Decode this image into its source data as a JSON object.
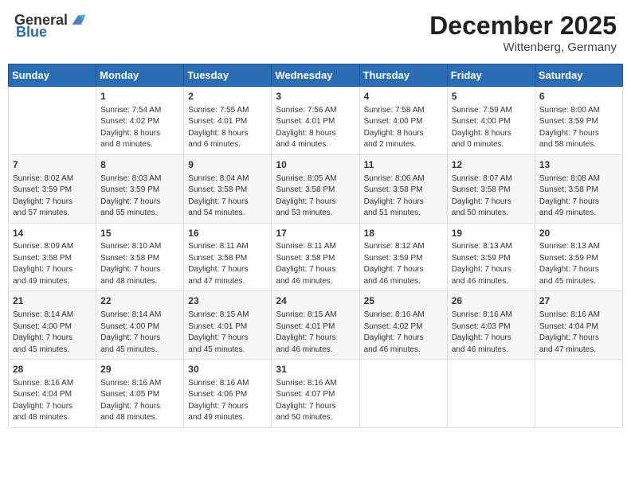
{
  "header": {
    "logo_general": "General",
    "logo_blue": "Blue",
    "title": "December 2025",
    "subtitle": "Wittenberg, Germany"
  },
  "days_of_week": [
    "Sunday",
    "Monday",
    "Tuesday",
    "Wednesday",
    "Thursday",
    "Friday",
    "Saturday"
  ],
  "weeks": [
    [
      {
        "day": "",
        "info": ""
      },
      {
        "day": "1",
        "info": "Sunrise: 7:54 AM\nSunset: 4:02 PM\nDaylight: 8 hours\nand 8 minutes."
      },
      {
        "day": "2",
        "info": "Sunrise: 7:55 AM\nSunset: 4:01 PM\nDaylight: 8 hours\nand 6 minutes."
      },
      {
        "day": "3",
        "info": "Sunrise: 7:56 AM\nSunset: 4:01 PM\nDaylight: 8 hours\nand 4 minutes."
      },
      {
        "day": "4",
        "info": "Sunrise: 7:58 AM\nSunset: 4:00 PM\nDaylight: 8 hours\nand 2 minutes."
      },
      {
        "day": "5",
        "info": "Sunrise: 7:59 AM\nSunset: 4:00 PM\nDaylight: 8 hours\nand 0 minutes."
      },
      {
        "day": "6",
        "info": "Sunrise: 8:00 AM\nSunset: 3:59 PM\nDaylight: 7 hours\nand 58 minutes."
      }
    ],
    [
      {
        "day": "7",
        "info": "Sunrise: 8:02 AM\nSunset: 3:59 PM\nDaylight: 7 hours\nand 57 minutes."
      },
      {
        "day": "8",
        "info": "Sunrise: 8:03 AM\nSunset: 3:59 PM\nDaylight: 7 hours\nand 55 minutes."
      },
      {
        "day": "9",
        "info": "Sunrise: 8:04 AM\nSunset: 3:58 PM\nDaylight: 7 hours\nand 54 minutes."
      },
      {
        "day": "10",
        "info": "Sunrise: 8:05 AM\nSunset: 3:58 PM\nDaylight: 7 hours\nand 53 minutes."
      },
      {
        "day": "11",
        "info": "Sunrise: 8:06 AM\nSunset: 3:58 PM\nDaylight: 7 hours\nand 51 minutes."
      },
      {
        "day": "12",
        "info": "Sunrise: 8:07 AM\nSunset: 3:58 PM\nDaylight: 7 hours\nand 50 minutes."
      },
      {
        "day": "13",
        "info": "Sunrise: 8:08 AM\nSunset: 3:58 PM\nDaylight: 7 hours\nand 49 minutes."
      }
    ],
    [
      {
        "day": "14",
        "info": "Sunrise: 8:09 AM\nSunset: 3:58 PM\nDaylight: 7 hours\nand 49 minutes."
      },
      {
        "day": "15",
        "info": "Sunrise: 8:10 AM\nSunset: 3:58 PM\nDaylight: 7 hours\nand 48 minutes."
      },
      {
        "day": "16",
        "info": "Sunrise: 8:11 AM\nSunset: 3:58 PM\nDaylight: 7 hours\nand 47 minutes."
      },
      {
        "day": "17",
        "info": "Sunrise: 8:11 AM\nSunset: 3:58 PM\nDaylight: 7 hours\nand 46 minutes."
      },
      {
        "day": "18",
        "info": "Sunrise: 8:12 AM\nSunset: 3:59 PM\nDaylight: 7 hours\nand 46 minutes."
      },
      {
        "day": "19",
        "info": "Sunrise: 8:13 AM\nSunset: 3:59 PM\nDaylight: 7 hours\nand 46 minutes."
      },
      {
        "day": "20",
        "info": "Sunrise: 8:13 AM\nSunset: 3:59 PM\nDaylight: 7 hours\nand 45 minutes."
      }
    ],
    [
      {
        "day": "21",
        "info": "Sunrise: 8:14 AM\nSunset: 4:00 PM\nDaylight: 7 hours\nand 45 minutes."
      },
      {
        "day": "22",
        "info": "Sunrise: 8:14 AM\nSunset: 4:00 PM\nDaylight: 7 hours\nand 45 minutes."
      },
      {
        "day": "23",
        "info": "Sunrise: 8:15 AM\nSunset: 4:01 PM\nDaylight: 7 hours\nand 45 minutes."
      },
      {
        "day": "24",
        "info": "Sunrise: 8:15 AM\nSunset: 4:01 PM\nDaylight: 7 hours\nand 46 minutes."
      },
      {
        "day": "25",
        "info": "Sunrise: 8:16 AM\nSunset: 4:02 PM\nDaylight: 7 hours\nand 46 minutes."
      },
      {
        "day": "26",
        "info": "Sunrise: 8:16 AM\nSunset: 4:03 PM\nDaylight: 7 hours\nand 46 minutes."
      },
      {
        "day": "27",
        "info": "Sunrise: 8:16 AM\nSunset: 4:04 PM\nDaylight: 7 hours\nand 47 minutes."
      }
    ],
    [
      {
        "day": "28",
        "info": "Sunrise: 8:16 AM\nSunset: 4:04 PM\nDaylight: 7 hours\nand 48 minutes."
      },
      {
        "day": "29",
        "info": "Sunrise: 8:16 AM\nSunset: 4:05 PM\nDaylight: 7 hours\nand 48 minutes."
      },
      {
        "day": "30",
        "info": "Sunrise: 8:16 AM\nSunset: 4:06 PM\nDaylight: 7 hours\nand 49 minutes."
      },
      {
        "day": "31",
        "info": "Sunrise: 8:16 AM\nSunset: 4:07 PM\nDaylight: 7 hours\nand 50 minutes."
      },
      {
        "day": "",
        "info": ""
      },
      {
        "day": "",
        "info": ""
      },
      {
        "day": "",
        "info": ""
      }
    ]
  ]
}
